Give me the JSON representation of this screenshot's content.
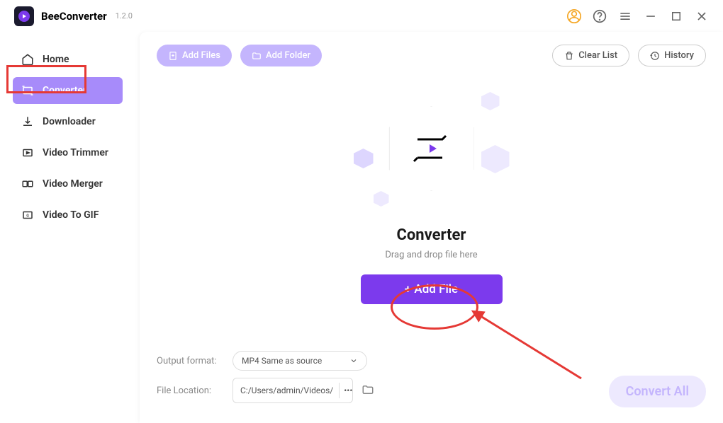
{
  "app": {
    "name": "BeeConverter",
    "version": "1.2.0"
  },
  "sidebar": {
    "items": [
      {
        "label": "Home",
        "icon": "home"
      },
      {
        "label": "Converter",
        "icon": "converter",
        "active": true
      },
      {
        "label": "Downloader",
        "icon": "download"
      },
      {
        "label": "Video Trimmer",
        "icon": "trimmer"
      },
      {
        "label": "Video Merger",
        "icon": "merger"
      },
      {
        "label": "Video To GIF",
        "icon": "gif"
      }
    ]
  },
  "toolbar": {
    "add_files_label": "Add Files",
    "add_folder_label": "Add Folder",
    "clear_list_label": "Clear List",
    "history_label": "History"
  },
  "center": {
    "title": "Converter",
    "subtitle": "Drag and drop file here",
    "add_file_label": "+ Add File"
  },
  "bottom": {
    "output_format_label": "Output format:",
    "output_format_value": "MP4 Same as source",
    "file_location_label": "File Location:",
    "file_location_value": "C:/Users/admin/Videos/",
    "convert_all_label": "Convert All"
  }
}
